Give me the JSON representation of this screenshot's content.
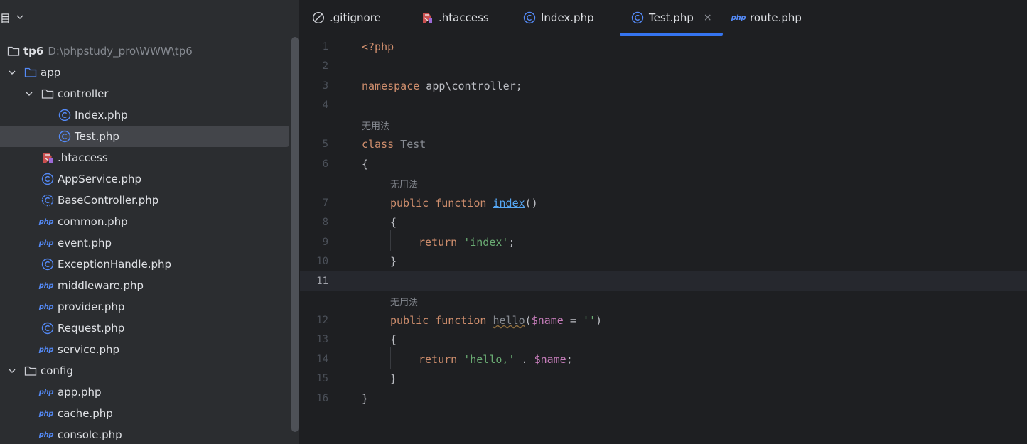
{
  "project": {
    "title": "目",
    "root": {
      "name": "tp6",
      "path": "D:\\phpstudy_pro\\WWW\\tp6"
    },
    "items": [
      {
        "label": "app"
      },
      {
        "label": "controller"
      },
      {
        "label": "Index.php"
      },
      {
        "label": "Test.php"
      },
      {
        "label": ".htaccess"
      },
      {
        "label": "AppService.php"
      },
      {
        "label": "BaseController.php"
      },
      {
        "label": "common.php"
      },
      {
        "label": "event.php"
      },
      {
        "label": "ExceptionHandle.php"
      },
      {
        "label": "middleware.php"
      },
      {
        "label": "provider.php"
      },
      {
        "label": "Request.php"
      },
      {
        "label": "service.php"
      },
      {
        "label": "config"
      },
      {
        "label": "app.php"
      },
      {
        "label": "cache.php"
      },
      {
        "label": "console.php"
      }
    ],
    "php_icon_text": "php"
  },
  "tabs": [
    {
      "label": ".gitignore"
    },
    {
      "label": ".htaccess"
    },
    {
      "label": "Index.php"
    },
    {
      "label": "Test.php",
      "close": "×"
    },
    {
      "label": "route.php"
    }
  ],
  "editor": {
    "line_numbers": [
      "1",
      "2",
      "3",
      "4",
      "5",
      "6",
      "7",
      "8",
      "9",
      "10",
      "11",
      "12",
      "13",
      "14",
      "15",
      "16"
    ],
    "hint_no_usages": "无用法",
    "code": {
      "l1": "<?php",
      "l3_kw": "namespace",
      "l3_rest": " app\\controller;",
      "l5_kw": "class",
      "l5_name": " Test",
      "open_brace": "{",
      "close_brace": "}",
      "public": "public",
      "function": " function ",
      "index_name": "index",
      "index_parens": "()",
      "return": "return",
      "index_str": " 'index'",
      "semicolon": ";",
      "hello_name": "hello",
      "hello_open": "(",
      "name_var": "$name",
      "eq": " = ",
      "empty_str": "''",
      "hello_close": ")",
      "hello_str": " 'hello,'",
      "dot": " . ",
      "name_var2": "$name",
      "semicolon2": ";"
    }
  },
  "colors": {
    "accent": "#3574f0",
    "keyword": "#cf8e6d",
    "string": "#6aab73",
    "variable": "#c77dbb",
    "function": "#56a8f5"
  }
}
